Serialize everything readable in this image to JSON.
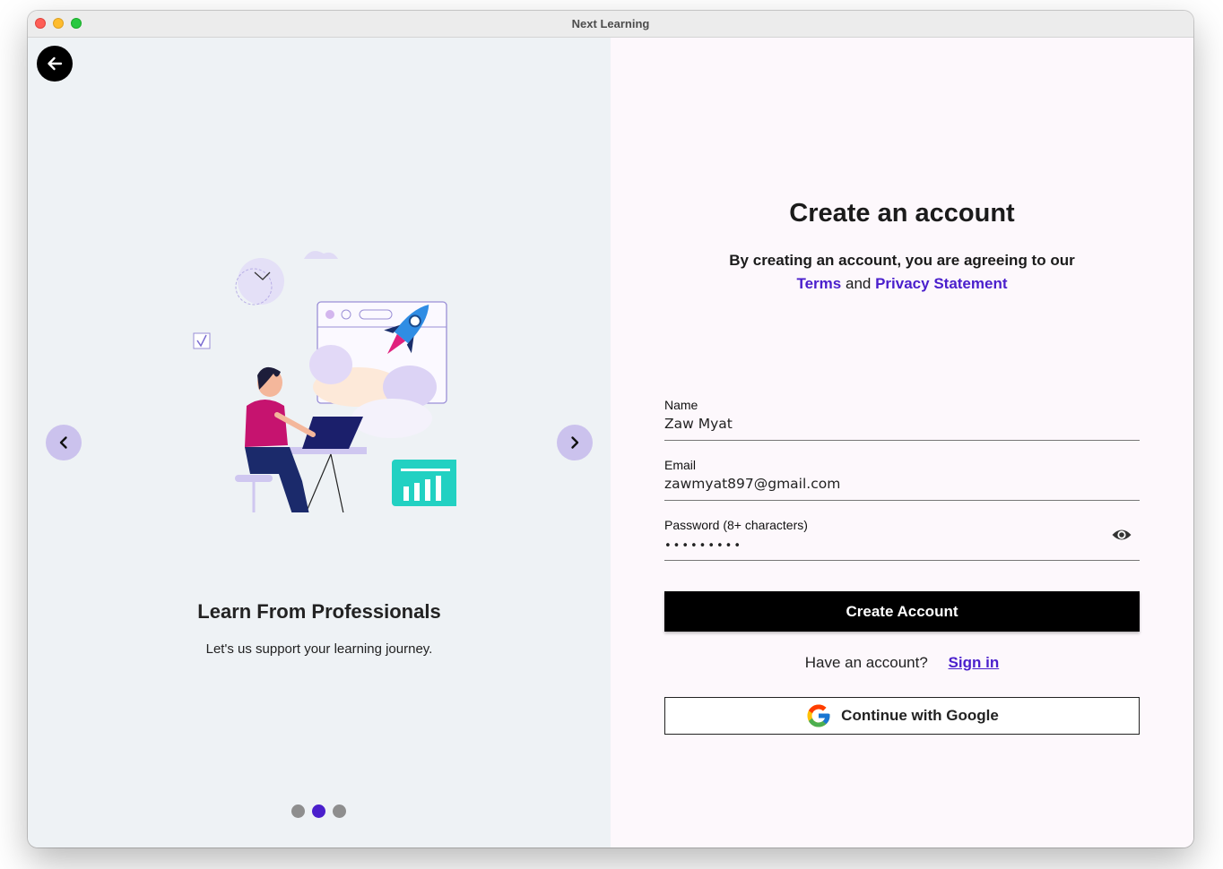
{
  "window": {
    "title": "Next Learning"
  },
  "left": {
    "back_icon": "arrow-left-icon",
    "prev_icon": "chevron-left-icon",
    "next_icon": "chevron-right-icon",
    "illustration": "woman-laptop-rocket-illustration",
    "slide_title": "Learn From Professionals",
    "slide_subtitle": "Let's us support your learning journey.",
    "dots": {
      "count": 3,
      "active_index": 1
    }
  },
  "form": {
    "title": "Create an account",
    "agree_text": "By creating an account, you are agreeing to our",
    "terms_label": "Terms",
    "and_text": "and",
    "privacy_label": "Privacy Statement",
    "name_label": "Name",
    "name_value": "Zaw Myat",
    "email_label": "Email",
    "email_value": "zawmyat897@gmail.com",
    "password_label": "Password (8+ characters)",
    "password_value": "•••••••••",
    "eye_icon": "eye-icon",
    "create_label": "Create Account",
    "have_account_text": "Have an account?",
    "signin_label": "Sign in",
    "google_label": "Continue with Google",
    "google_icon": "google-logo-icon"
  },
  "colors": {
    "accent": "#4a1fcc",
    "nav_button": "#cbc2ed",
    "left_bg": "#eef2f5",
    "right_bg": "#fdf8fc",
    "primary_button": "#000000"
  }
}
